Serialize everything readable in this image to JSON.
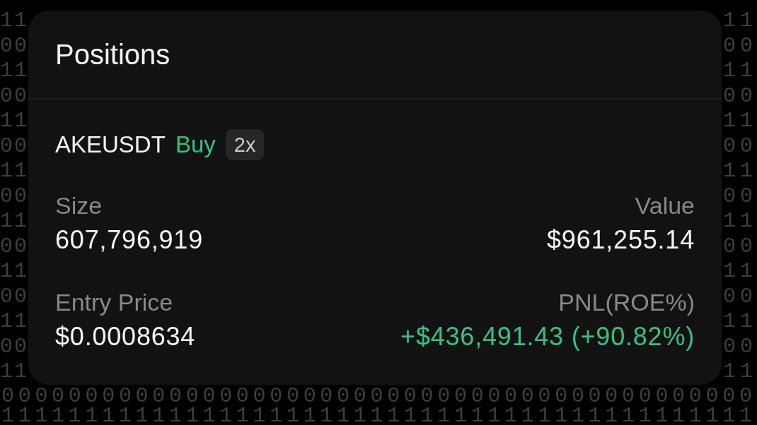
{
  "backdrop": {
    "left_column": [
      "11",
      "00",
      "11",
      "00",
      "11",
      "00",
      "11",
      "00",
      "11",
      "00",
      "11",
      "00",
      "11",
      "00",
      "11"
    ],
    "right_column": [
      "11",
      "00",
      "11",
      "00",
      "11",
      "00",
      "11",
      "00",
      "11",
      "00",
      "11",
      "00",
      "11",
      "00",
      "11"
    ],
    "bottom_rows": [
      "000000000000000000000000000000000000000000000",
      "111111111111111111111111111111111111111111111"
    ]
  },
  "card": {
    "title": "Positions",
    "position": {
      "symbol": "AKEUSDT",
      "side": {
        "label": "Buy",
        "kind": "buy"
      },
      "leverage": "2x"
    },
    "stats": [
      {
        "label": "Size",
        "value": "607,796,919",
        "kind": "plain"
      },
      {
        "label": "Value",
        "value": "$961,255.14",
        "kind": "plain"
      },
      {
        "label": "Entry Price",
        "value": "$0.0008634",
        "kind": "plain"
      },
      {
        "label": "PNL(ROE%)",
        "value": "+$436,491.43 (+90.82%)",
        "kind": "gain"
      }
    ]
  }
}
